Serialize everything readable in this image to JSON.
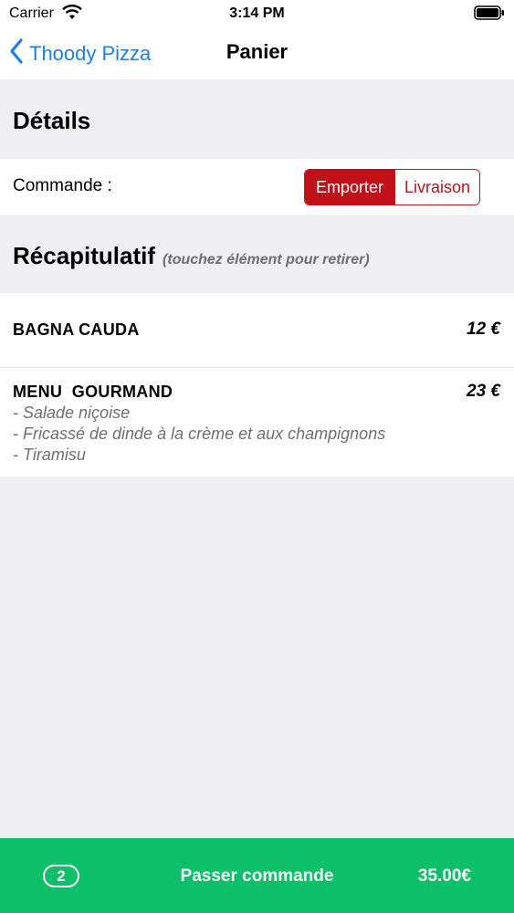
{
  "status_bar": {
    "carrier": "Carrier",
    "time": "3:14 PM"
  },
  "nav": {
    "back_label": "Thoody Pizza",
    "title": "Panier"
  },
  "details": {
    "title": "Détails",
    "order_label": "Commande :",
    "options": [
      "Emporter",
      "Livraison"
    ],
    "selected": "Emporter"
  },
  "summary": {
    "title": "Récapitulatif",
    "hint": "(touchez élément pour retirer)"
  },
  "cart": {
    "items": [
      {
        "name": "BAGNA CAUDA",
        "price": "12 €",
        "details": []
      },
      {
        "name": "MENU  GOURMAND",
        "price": "23 €",
        "details": [
          "- Salade niçoise",
          "- Fricassé de dinde à la crème et aux champignons",
          "- Tiramisu"
        ]
      }
    ]
  },
  "checkout": {
    "count": "2",
    "label": "Passer commande",
    "total": "35.00€"
  },
  "colors": {
    "accent": "#c0111a",
    "link": "#1a7fe6",
    "checkout": "#0cbf69",
    "background": "#efeff4"
  }
}
